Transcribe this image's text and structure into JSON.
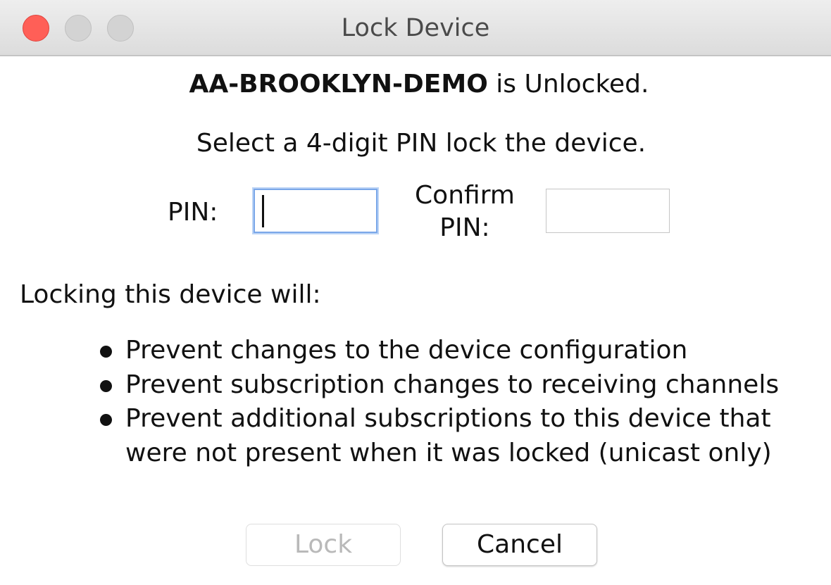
{
  "window": {
    "title": "Lock Device"
  },
  "status": {
    "device_name": "AA-BROOKLYN-DEMO",
    "state_text": " is Unlocked."
  },
  "instruction": "Select a 4-digit PIN lock the device.",
  "pin_field": {
    "label": "PIN:",
    "value": ""
  },
  "confirm_field": {
    "label_line1": "Confirm",
    "label_line2": "PIN:",
    "value": ""
  },
  "consequences": {
    "heading": "Locking this device will:",
    "items": [
      {
        "text": "Prevent changes to the device configuration"
      },
      {
        "text": "Prevent subscription changes to receiving channels"
      },
      {
        "text": "Prevent additional subscriptions to this device that",
        "text_line2": "were not present when it was locked (unicast only)"
      }
    ]
  },
  "buttons": {
    "lock_label": "Lock",
    "lock_enabled": false,
    "cancel_label": "Cancel"
  },
  "colors": {
    "close_button": "#ff5f57",
    "focus_ring": "#7aa7e9",
    "disabled_text": "#b9b9b9"
  }
}
